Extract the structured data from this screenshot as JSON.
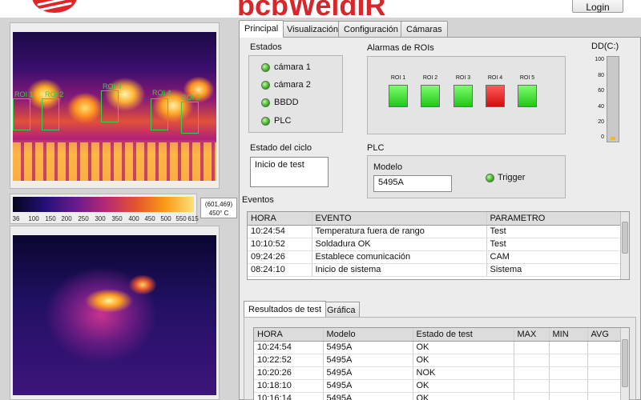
{
  "header": {
    "brand": "bcbWeldIR",
    "login_label": "Login",
    "colors": {
      "brand": "#d7262c"
    }
  },
  "tabs": [
    {
      "label": "Principal",
      "active": true
    },
    {
      "label": "Visualización",
      "active": false
    },
    {
      "label": "Configuración",
      "active": false
    },
    {
      "label": "Cámaras",
      "active": false
    }
  ],
  "thermal_top": {
    "rois": [
      "ROI 1",
      "ROI 2",
      "ROI 3",
      "ROI 4",
      "ROI 5"
    ]
  },
  "color_scale": {
    "ticks": [
      "36",
      "100",
      "150",
      "200",
      "250",
      "300",
      "350",
      "400",
      "450",
      "500",
      "550",
      "615"
    ],
    "readout_coords": "(601,469)",
    "readout_temp": "450° C"
  },
  "estados": {
    "title": "Estados",
    "items": [
      {
        "label": "cámara 1",
        "status": "ok"
      },
      {
        "label": "cámara 2",
        "status": "ok"
      },
      {
        "label": "BBDD",
        "status": "ok"
      },
      {
        "label": "PLC",
        "status": "ok"
      }
    ]
  },
  "alarmas": {
    "title": "Alarmas de ROIs",
    "items": [
      {
        "label": "ROI 1",
        "status": "ok"
      },
      {
        "label": "ROI 2",
        "status": "ok"
      },
      {
        "label": "ROI 3",
        "status": "ok"
      },
      {
        "label": "ROI 4",
        "status": "alarm"
      },
      {
        "label": "ROI 5",
        "status": "ok"
      }
    ],
    "colors": {
      "ok": "#33d12a",
      "alarm": "#e21414"
    }
  },
  "disk": {
    "title": "DD(C:)",
    "ticks": [
      "100",
      "80",
      "60",
      "40",
      "20",
      "0"
    ],
    "level": 4
  },
  "ciclo": {
    "title": "Estado del ciclo",
    "value": "Inicio de test"
  },
  "plc": {
    "title": "PLC",
    "modelo_label": "Modelo",
    "modelo_value": "5495A",
    "trigger_label": "Trigger"
  },
  "eventos": {
    "title": "Eventos",
    "columns": [
      "HORA",
      "EVENTO",
      "PARAMETRO"
    ],
    "rows": [
      [
        "10:24:54",
        "Temperatura fuera de rango",
        "Test"
      ],
      [
        "10:10:52",
        "Soldadura OK",
        "Test"
      ],
      [
        "09:24:26",
        "Establece comunicación",
        "CAM"
      ],
      [
        "08:24:10",
        "Inicio de sistema",
        "Sistema"
      ]
    ]
  },
  "resultados": {
    "tabs": [
      {
        "label": "Resultados de test",
        "active": true
      },
      {
        "label": "Gráfica",
        "active": false
      }
    ],
    "columns": [
      "HORA",
      "Modelo",
      "Estado de test",
      "MAX",
      "MIN",
      "AVG"
    ],
    "rows": [
      [
        "10:24:54",
        "5495A",
        "OK",
        "",
        "",
        ""
      ],
      [
        "10:22:52",
        "5495A",
        "OK",
        "",
        "",
        ""
      ],
      [
        "10:20:26",
        "5495A",
        "NOK",
        "",
        "",
        ""
      ],
      [
        "10:18:10",
        "5495A",
        "OK",
        "",
        "",
        ""
      ],
      [
        "10:16:14",
        "5495A",
        "OK",
        "",
        "",
        ""
      ]
    ]
  }
}
